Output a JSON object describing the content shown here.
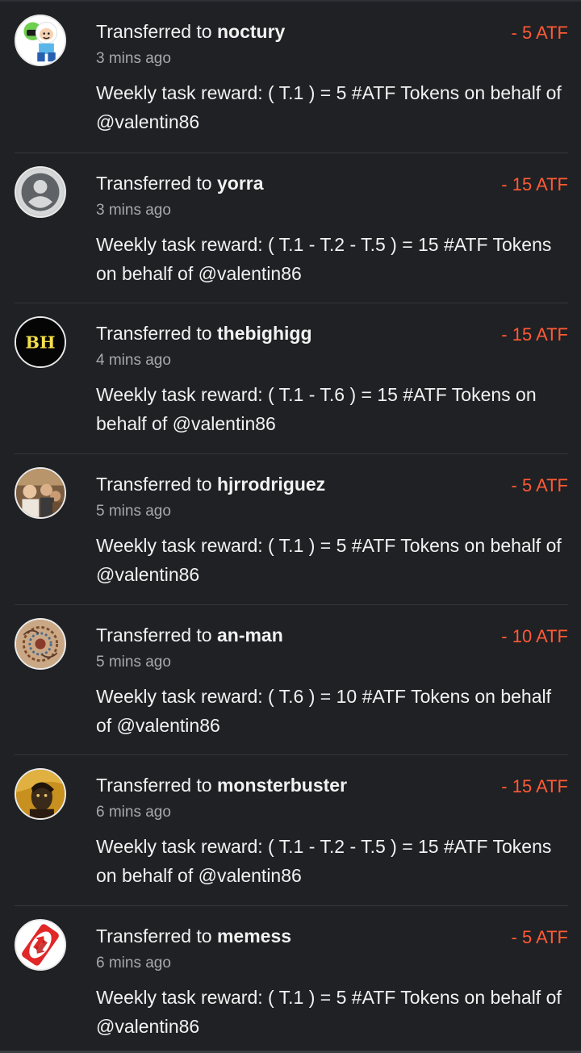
{
  "colors": {
    "background": "#1f2124",
    "amount": "#ff5a36",
    "muted": "#a6a8ab",
    "text": "#f2f2f2"
  },
  "transfers": [
    {
      "prefix": "Transferred to",
      "username": "noctury",
      "amount": "- 5 ATF",
      "time": "3 mins ago",
      "memo": "Weekly task reward: ( T.1 ) = 5 #ATF Tokens on behalf of @valentin86",
      "avatar_icon": "cartoon-character-avatar-icon"
    },
    {
      "prefix": "Transferred to",
      "username": "yorra",
      "amount": "- 15 ATF",
      "time": "3 mins ago",
      "memo": "Weekly task reward: ( T.1 - T.2 - T.5 ) = 15 #ATF Tokens on behalf of @valentin86",
      "avatar_icon": "default-user-avatar-icon"
    },
    {
      "prefix": "Transferred to",
      "username": "thebighigg",
      "amount": "- 15 ATF",
      "time": "4 mins ago",
      "memo": "Weekly task reward: ( T.1 - T.6 ) = 15 #ATF Tokens on behalf of @valentin86",
      "avatar_icon": "bh-logo-avatar-icon",
      "avatar_text": "BH"
    },
    {
      "prefix": "Transferred to",
      "username": "hjrrodriguez",
      "amount": "- 5 ATF",
      "time": "5 mins ago",
      "memo": "Weekly task reward: ( T.1 ) = 5 #ATF Tokens on behalf of @valentin86",
      "avatar_icon": "group-photo-avatar-icon"
    },
    {
      "prefix": "Transferred to",
      "username": "an-man",
      "amount": "- 10 ATF",
      "time": "5 mins ago",
      "memo": "Weekly task reward: ( T.6 ) = 10 #ATF Tokens on behalf of @valentin86",
      "avatar_icon": "pattern-art-avatar-icon"
    },
    {
      "prefix": "Transferred to",
      "username": "monsterbuster",
      "amount": "- 15 ATF",
      "time": "6 mins ago",
      "memo": "Weekly task reward: ( T.1 - T.2 - T.5 ) = 15 #ATF Tokens on behalf of @valentin86",
      "avatar_icon": "portrait-art-avatar-icon"
    },
    {
      "prefix": "Transferred to",
      "username": "memess",
      "amount": "- 5 ATF",
      "time": "6 mins ago",
      "memo": "Weekly task reward: ( T.1 ) = 5 #ATF Tokens on behalf of @valentin86",
      "avatar_icon": "reverse-card-avatar-icon"
    }
  ]
}
